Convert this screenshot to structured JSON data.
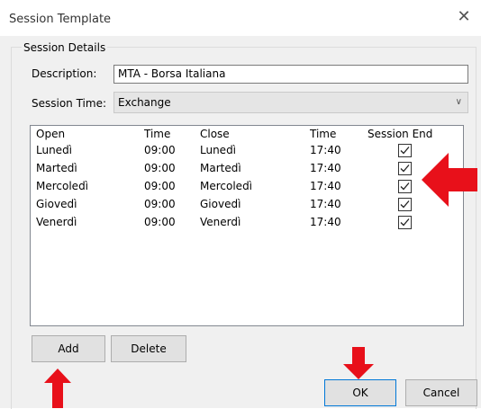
{
  "window": {
    "title": "Session Template",
    "close_icon": "close-icon"
  },
  "session_details": {
    "group_label": "Session Details",
    "description_label": "Description:",
    "description_value": "MTA - Borsa Italiana",
    "session_time_label": "Session Time:",
    "session_time_value": "Exchange"
  },
  "table": {
    "columns": [
      "Open",
      "Time",
      "Close",
      "Time",
      "Session End"
    ],
    "rows": [
      {
        "open": "Lunedì",
        "open_time": "09:00",
        "close": "Lunedì",
        "close_time": "17:40",
        "session_end": true
      },
      {
        "open": "Martedì",
        "open_time": "09:00",
        "close": "Martedì",
        "close_time": "17:40",
        "session_end": true
      },
      {
        "open": "Mercoledì",
        "open_time": "09:00",
        "close": "Mercoledì",
        "close_time": "17:40",
        "session_end": true
      },
      {
        "open": "Giovedì",
        "open_time": "09:00",
        "close": "Giovedì",
        "close_time": "17:40",
        "session_end": true
      },
      {
        "open": "Venerdì",
        "open_time": "09:00",
        "close": "Venerdì",
        "close_time": "17:40",
        "session_end": true
      }
    ]
  },
  "buttons": {
    "add": "Add",
    "delete": "Delete",
    "ok": "OK",
    "cancel": "Cancel"
  },
  "colors": {
    "annotation_arrow": "#e8101a",
    "window_bg": "#f0f0f0"
  }
}
